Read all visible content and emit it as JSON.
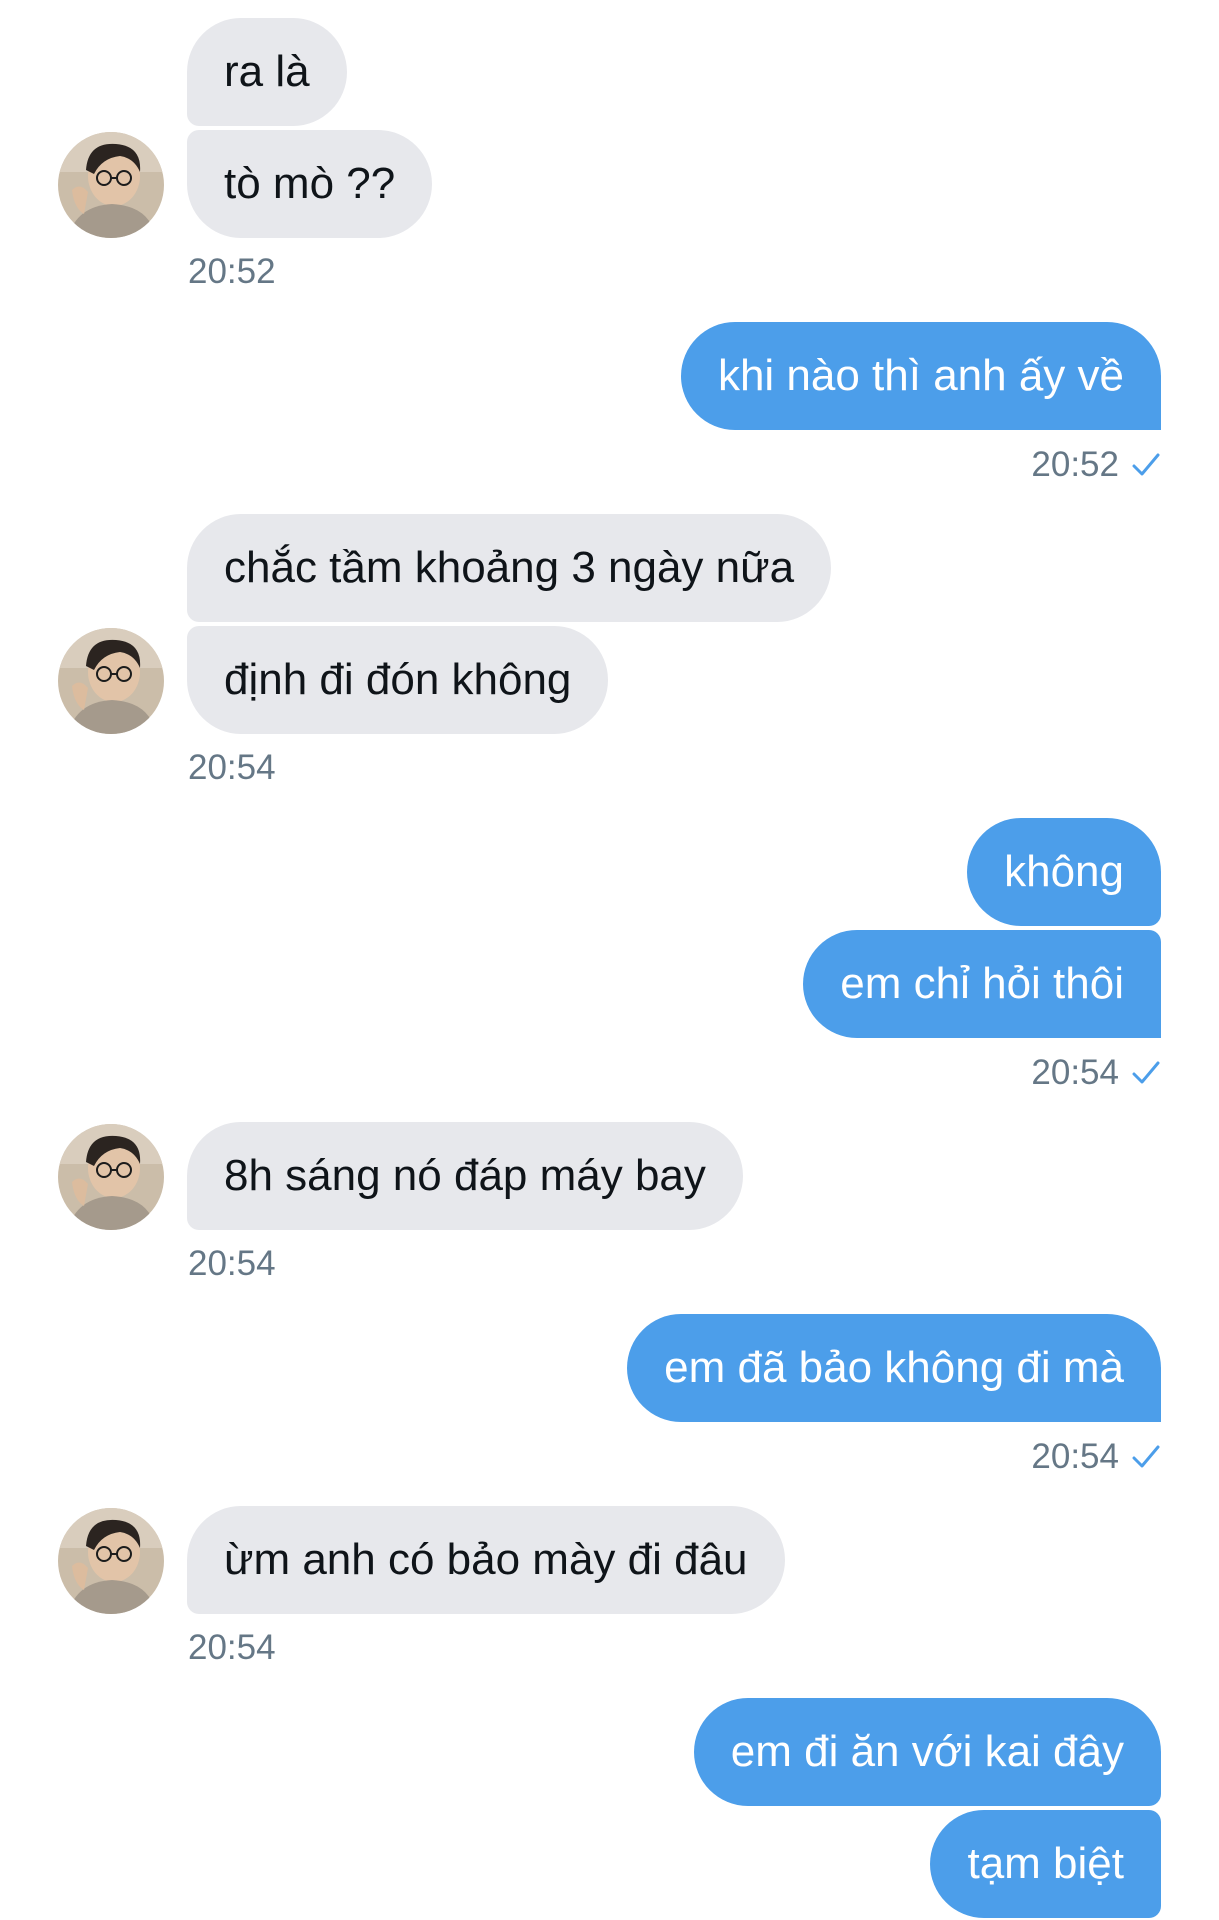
{
  "conversation": {
    "messages": [
      {
        "side": "in",
        "text": "ra là"
      },
      {
        "side": "in",
        "text": "tò mò ??"
      },
      {
        "side": "out",
        "text": "khi nào thì anh ấy về"
      },
      {
        "side": "in",
        "text": "chắc tầm khoảng 3 ngày nữa"
      },
      {
        "side": "in",
        "text": "định đi đón không"
      },
      {
        "side": "out",
        "text": "không"
      },
      {
        "side": "out",
        "text": "em chỉ hỏi thôi"
      },
      {
        "side": "in",
        "text": "8h sáng nó đáp máy bay"
      },
      {
        "side": "out",
        "text": "em đã bảo không đi mà"
      },
      {
        "side": "in",
        "text": "ừm anh có bảo mày đi đâu"
      },
      {
        "side": "out",
        "text": "em đi ăn với kai đây"
      },
      {
        "side": "out",
        "text": "tạm biệt"
      }
    ],
    "timestamps": [
      "20:52",
      "20:52",
      "20:54",
      "20:54",
      "20:54",
      "20:54",
      "20:54"
    ],
    "read_receipt_icon": "check-icon"
  },
  "colors": {
    "incoming_bubble": "#e7e8ec",
    "outgoing_bubble": "#4c9eea",
    "timestamp": "#657786",
    "check": "#4c9eea"
  }
}
